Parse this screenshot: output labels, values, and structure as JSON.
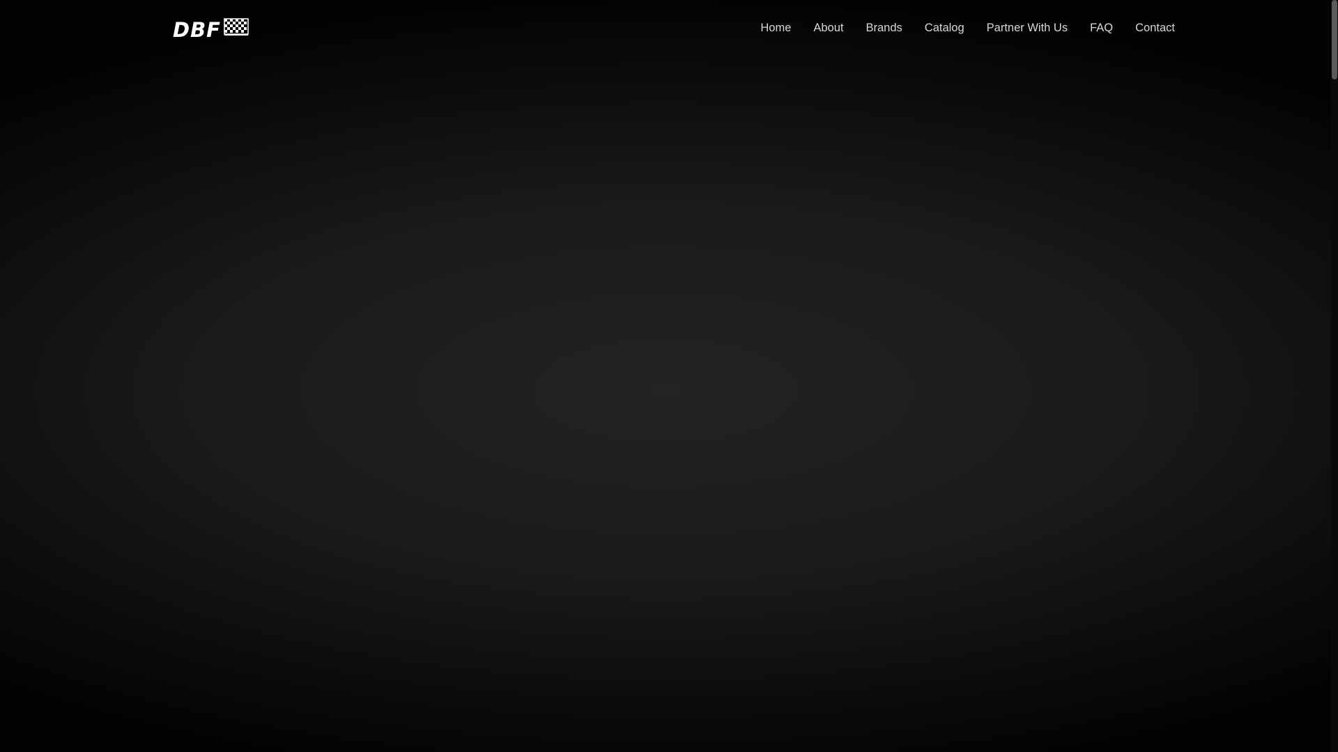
{
  "brand": {
    "logo_text": "DBF",
    "logo_icon": "checkered-flag-icon"
  },
  "nav": {
    "items": [
      {
        "label": "Home"
      },
      {
        "label": "About"
      },
      {
        "label": "Brands"
      },
      {
        "label": "Catalog"
      },
      {
        "label": "Partner With Us"
      },
      {
        "label": "FAQ"
      },
      {
        "label": "Contact"
      }
    ]
  },
  "colors": {
    "background": "#000000",
    "hero_center": "#232323",
    "nav_text": "#d8d8d8",
    "scrollbar_thumb": "#5a5a5a"
  }
}
